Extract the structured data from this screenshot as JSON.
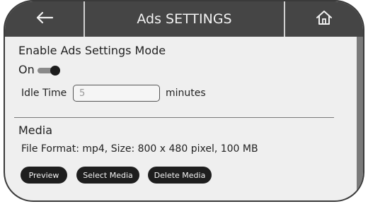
{
  "header": {
    "title": "Ads SETTINGS",
    "back_icon": "arrow-left-icon",
    "home_icon": "home-icon"
  },
  "ads_mode": {
    "label": "Enable Ads Settings Mode",
    "state_label": "On",
    "enabled": true
  },
  "idle": {
    "label": "Idle Time",
    "placeholder": "5",
    "unit": "minutes"
  },
  "media": {
    "heading": "Media",
    "spec": "File Format: mp4, Size: 800 x 480 pixel, 100 MB",
    "buttons": {
      "preview": "Preview",
      "select": "Select Media",
      "delete": "Delete Media"
    }
  },
  "colors": {
    "header_bg": "#454545",
    "panel_bg": "#efefef",
    "button_bg": "#1e1e1e"
  }
}
